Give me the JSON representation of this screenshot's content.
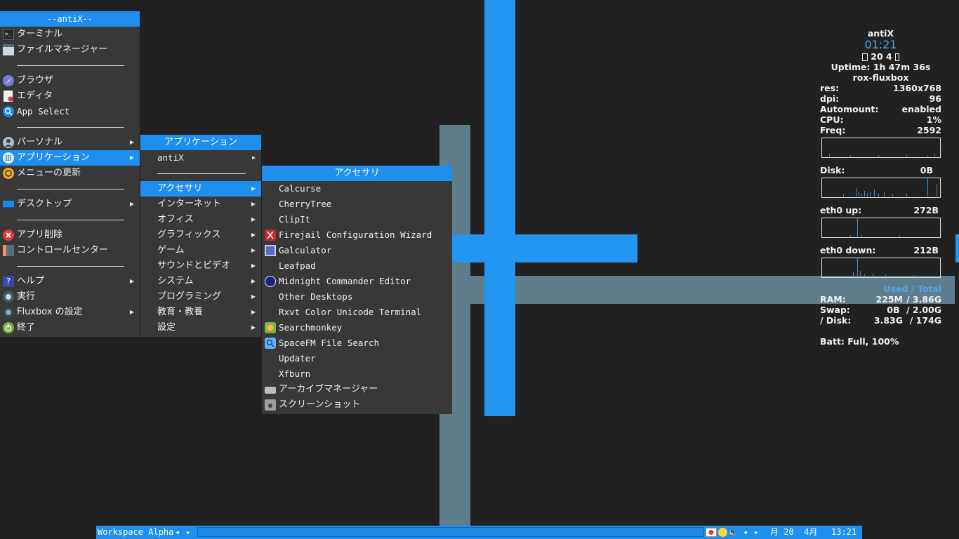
{
  "main_menu": {
    "title": "--antiX--",
    "items": {
      "terminal": "ターミナル",
      "file_manager": "ファイルマネージャー",
      "browser": "ブラウザ",
      "editor": "エディタ",
      "app_select": "App Select",
      "personal": "パーソナル",
      "applications": "アプリケーション",
      "menu_update": "メニューの更新",
      "desktop": "デスクトップ",
      "app_remove": "アプリ削除",
      "control_centre": "コントロールセンター",
      "help": "ヘルプ",
      "run": "実行",
      "fluxbox_settings": "Fluxbox の設定",
      "exit": "終了"
    }
  },
  "apps_menu": {
    "title": "アプリケーション",
    "items": [
      "antiX",
      "アクセサリ",
      "インターネット",
      "オフィス",
      "グラフィックス",
      "ゲーム",
      "サウンドとビデオ",
      "システム",
      "プログラミング",
      "教育・教養",
      "設定"
    ]
  },
  "accessories_menu": {
    "title": "アクセサリ",
    "items": [
      "Calcurse",
      "CherryTree",
      "ClipIt",
      "Firejail Configuration Wizard",
      "Galculator",
      "Leafpad",
      "Midnight Commander Editor",
      "Other Desktops",
      "Rxvt Color Unicode Terminal",
      "Searchmonkey",
      "SpaceFM File Search",
      "Updater",
      "Xfburn",
      "アーカイブマネージャー",
      "スクリーンショット"
    ]
  },
  "conky": {
    "hostname": "antiX",
    "time": "01:21",
    "date": "20 4",
    "uptime": "Uptime: 1h 47m 36s",
    "session": "rox-fluxbox",
    "rows": [
      {
        "label": "res:",
        "value": "1360x768"
      },
      {
        "label": "dpi:",
        "value": "96"
      },
      {
        "label": "Automount:",
        "value": "enabled"
      },
      {
        "label": "CPU:",
        "value": "1%"
      },
      {
        "label": "Freq:",
        "value": "2592"
      }
    ],
    "disk": {
      "label": "Disk:",
      "value": "0B"
    },
    "eth_up": {
      "label": "eth0 up:",
      "value": "272B"
    },
    "eth_down": {
      "label": "eth0 down:",
      "value": "212B"
    },
    "used_total": "Used / Total",
    "mem_rows": [
      {
        "label": "RAM:",
        "used": "225M",
        "total": "/ 3.86G"
      },
      {
        "label": "Swap:",
        "used": "0B",
        "total": "/ 2.00G"
      },
      {
        "label": "/ Disk:",
        "used": "3.83G",
        "total": "/ 174G"
      }
    ],
    "battery": "Batt: Full, 100%"
  },
  "taskbar": {
    "workspace": "Workspace Alpha",
    "date": "月 20  4月",
    "time": "13:21"
  },
  "colors": {
    "accent": "#1e8fef",
    "menu_bg": "#383838",
    "desktop_bg": "#212121",
    "slate": "#607d8b"
  }
}
